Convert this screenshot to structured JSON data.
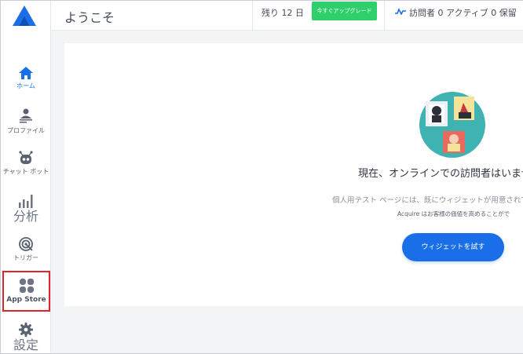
{
  "colors": {
    "accent": "#1a6fe8",
    "upgrade": "#2fcf6b",
    "highlight_border": "#e0242b",
    "background": "#f3f4f6"
  },
  "sidebar": {
    "items": [
      {
        "name": "home",
        "icon": "home-icon",
        "label": "ホーム"
      },
      {
        "name": "profile",
        "icon": "profile-icon",
        "label": "プロファイル"
      },
      {
        "name": "chatbot",
        "icon": "robot-icon",
        "label": "チャット ボット"
      },
      {
        "name": "analytics",
        "icon": "bar-chart-icon",
        "label": "分析"
      },
      {
        "name": "trigger",
        "icon": "target-icon",
        "label": "トリガー"
      },
      {
        "name": "appstore",
        "icon": "grid-icon",
        "label": "App Store"
      },
      {
        "name": "settings",
        "icon": "gear-icon",
        "label": "設定"
      }
    ]
  },
  "header": {
    "title": "ようこそ",
    "trial_text": "残り 12 日",
    "upgrade_label": "今すぐアップグレード",
    "stats_text": "訪問者 0 アクティブ 0 保留"
  },
  "main": {
    "headline": "現在、オンラインでの訪問者はいませ",
    "description": "個人用テスト ページには、既にウィジェットが用意されてい",
    "subdescription": "Acquire はお客様の価値を高めることがで",
    "cta_label": "ウィジェットを試す"
  }
}
